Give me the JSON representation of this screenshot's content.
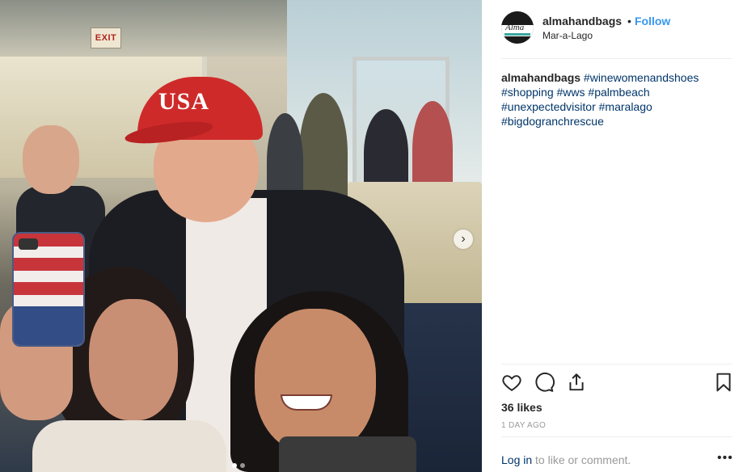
{
  "photo": {
    "exit_sign": "EXIT",
    "cap_text": "USA",
    "carousel": {
      "total_slides": 2,
      "active_slide": 1,
      "next_icon": "chevron-right-icon"
    }
  },
  "header": {
    "username": "almahandbags",
    "separator": "•",
    "follow_label": "Follow",
    "location": "Mar-a-Lago"
  },
  "caption": {
    "username": "almahandbags",
    "hashtags": [
      "#winewomenandshoes",
      "#shopping",
      "#wws",
      "#palmbeach",
      "#unexpectedvisitor",
      "#maralago",
      "#bigdogranchrescue"
    ]
  },
  "actions": {
    "like_icon": "heart-icon",
    "comment_icon": "comment-icon",
    "share_icon": "share-icon",
    "save_icon": "bookmark-icon"
  },
  "likes": "36 likes",
  "timestamp": "1 DAY AGO",
  "comment_prompt": {
    "login_label": "Log in",
    "rest": "to like or comment."
  },
  "more_label": "•••",
  "colors": {
    "link_blue": "#3897f0",
    "hashtag_blue": "#003569",
    "muted": "#999999"
  }
}
